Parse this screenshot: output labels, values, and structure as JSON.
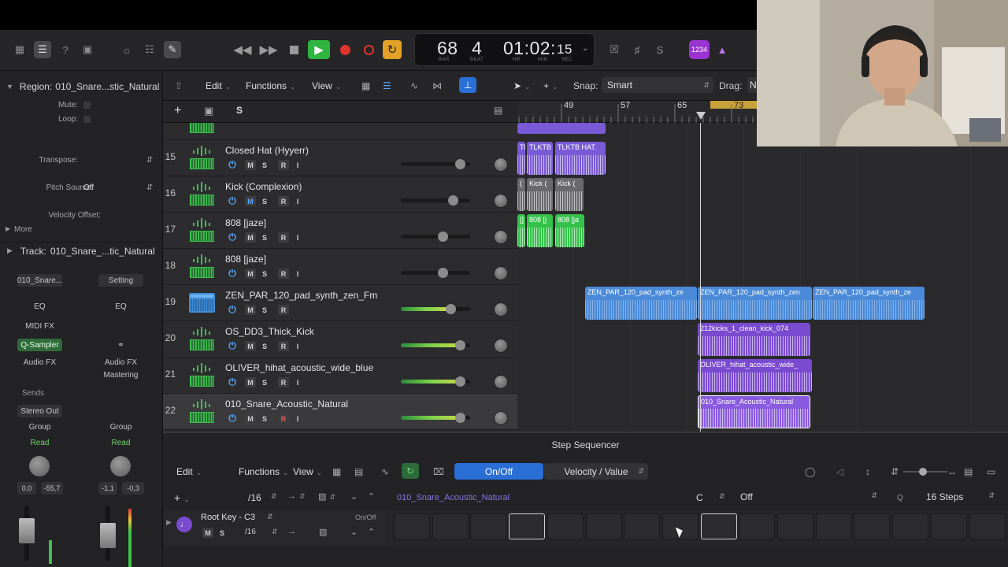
{
  "control_bar": {
    "lcd": {
      "bar": "68",
      "beat": "4",
      "bar_label": "BAR",
      "beat_label": "BEAT",
      "time_main": "01:02:",
      "time_sec": "15",
      "hr_label": "HR",
      "min_label": "MIN",
      "sec_label": "SEC"
    },
    "count_in": "1234",
    "icons": [
      "library-icon",
      "inspector-icon",
      "help-icon",
      "toolbar-icon",
      "brightness-icon",
      "mixer-icon",
      "pencil-icon",
      "rewind-icon",
      "fast-forward-icon",
      "stop-icon",
      "play-icon",
      "record-icon",
      "capture-record-icon",
      "cycle-icon",
      "replace-icon",
      "tuner-icon",
      "score-icon",
      "metronome-icon"
    ],
    "colors": {
      "play": "#2fb540",
      "record": "#e0332e",
      "cycle": "#e2a226",
      "count_in": "#9a33d1"
    }
  },
  "inspector": {
    "region_label": "Region:",
    "region_name": "010_Snare...stic_Natural",
    "mute_label": "Mute:",
    "loop_label": "Loop:",
    "transpose_label": "Transpose:",
    "pitch_source_label": "Pitch Source:",
    "pitch_source_value": "Off",
    "velocity_offset_label": "Velocity Offset:",
    "more_label": "More",
    "track_label": "Track:",
    "track_name": "010_Snare_...tic_Natural",
    "strip_left": {
      "name": "010_Snare...",
      "eq": "EQ",
      "midi_fx": "MIDI FX",
      "instrument": "Q-Sampler",
      "audio_fx": "Audio FX",
      "sends": "Sends",
      "output": "Stereo Out",
      "group": "Group",
      "automation": "Read",
      "pan_value": "0,0",
      "level_value": "-55,7"
    },
    "strip_right": {
      "name": "Setting",
      "eq": "EQ",
      "audio_fx": "Audio FX",
      "mastering": "Mastering",
      "group": "Group",
      "automation": "Read",
      "pan_value": "-1,1",
      "level_value": "-0,3"
    }
  },
  "edit_bar": {
    "edit": "Edit",
    "functions": "Functions",
    "view": "View",
    "snap_label": "Snap:",
    "snap_value": "Smart",
    "drag_label": "Drag:",
    "drag_value": "N"
  },
  "track_bar": {
    "add": "+",
    "s": "S"
  },
  "ruler": {
    "marks": [
      "49",
      "57",
      "65",
      "73"
    ]
  },
  "tracks": [
    {
      "num": "15",
      "name": "Closed Hat (Hyyerr)",
      "buttons": [
        "M",
        "S",
        "R",
        "I"
      ],
      "volume": 0.85,
      "m_on": false,
      "r_on": false,
      "green": false
    },
    {
      "num": "16",
      "name": "Kick (Complexion)",
      "buttons": [
        "M",
        "S",
        "R",
        "I"
      ],
      "volume": 0.75,
      "m_on": true,
      "r_on": false,
      "green": false
    },
    {
      "num": "17",
      "name": "808 [jaze]",
      "buttons": [
        "M",
        "S",
        "R",
        "I"
      ],
      "volume": 0.6,
      "m_on": false,
      "r_on": false,
      "green": false
    },
    {
      "num": "18",
      "name": "808 [jaze]",
      "buttons": [
        "M",
        "S",
        "R",
        "I"
      ],
      "volume": 0.6,
      "m_on": false,
      "r_on": false,
      "green": false
    },
    {
      "num": "19",
      "name": "ZEN_PAR_120_pad_synth_zen_Fm",
      "buttons": [
        "M",
        "S",
        "R"
      ],
      "volume": 0.72,
      "m_on": false,
      "r_on": false,
      "green": true
    },
    {
      "num": "20",
      "name": "OS_DD3_Thick_Kick",
      "buttons": [
        "M",
        "S",
        "R",
        "I"
      ],
      "volume": 0.85,
      "m_on": false,
      "r_on": false,
      "green": true
    },
    {
      "num": "21",
      "name": "OLIVER_hihat_acoustic_wide_blue",
      "buttons": [
        "M",
        "S",
        "R",
        "I"
      ],
      "volume": 0.85,
      "m_on": false,
      "r_on": false,
      "green": true
    },
    {
      "num": "22",
      "name": "010_Snare_Acoustic_Natural",
      "buttons": [
        "M",
        "S",
        "R",
        "I"
      ],
      "volume": 0.85,
      "m_on": false,
      "r_on": true,
      "green": true
    }
  ],
  "regions": [
    {
      "name": "TB",
      "track": 0,
      "color": "#7a5ad6"
    },
    {
      "name": "TLKTB",
      "track": 0,
      "color": "#7a5ad6"
    },
    {
      "name": "TLKTB HAT.",
      "track": 0,
      "color": "#7a5ad6"
    },
    {
      "name": "(",
      "track": 1,
      "color": "#6a6a6e"
    },
    {
      "name": "Kick (",
      "track": 1,
      "color": "#6a6a6e"
    },
    {
      "name": "Kick (",
      "track": 1,
      "color": "#6a6a6e"
    },
    {
      "name": "[]",
      "track": 2,
      "color": "#35c24a"
    },
    {
      "name": "808 [j",
      "track": 2,
      "color": "#35c24a"
    },
    {
      "name": "808 [ja",
      "track": 2,
      "color": "#35c24a"
    },
    {
      "name": "ZEN_PAR_120_pad_synth_ze",
      "track": 4,
      "color": "#4a8ad8"
    },
    {
      "name": "ZEN_PAR_120_pad_synth_zen",
      "track": 4,
      "color": "#4a8ad8"
    },
    {
      "name": "ZEN_PAR_120_pad_synth_ze",
      "track": 4,
      "color": "#4a8ad8"
    },
    {
      "name": "212kicks_1_clean_kick_074",
      "track": 5,
      "color": "#7a4ad0"
    },
    {
      "name": "OLIVER_hihat_acoustic_wide_",
      "track": 6,
      "color": "#7a4ad0"
    },
    {
      "name": "010_Snare_Acoustic_Natural",
      "track": 7,
      "color": "#8a5ae0"
    }
  ],
  "step_sequencer": {
    "title": "Step Sequencer",
    "edit": "Edit",
    "functions": "Functions",
    "view": "View",
    "mode_on_off": "On/Off",
    "mode_velocity": "Velocity / Value",
    "resolution": "/16",
    "pattern_name": "010_Snare_Acoustic_Natural",
    "key": "C",
    "scale": "Off",
    "quantize": "Q",
    "steps": "16 Steps",
    "row": {
      "name": "Root Key - C3",
      "state": "On/Off",
      "m": "M",
      "s": "S",
      "resolution": "/16"
    },
    "pads": [
      false,
      false,
      false,
      true,
      false,
      false,
      false,
      false,
      true,
      false,
      false,
      false,
      false,
      false,
      false,
      false
    ]
  }
}
